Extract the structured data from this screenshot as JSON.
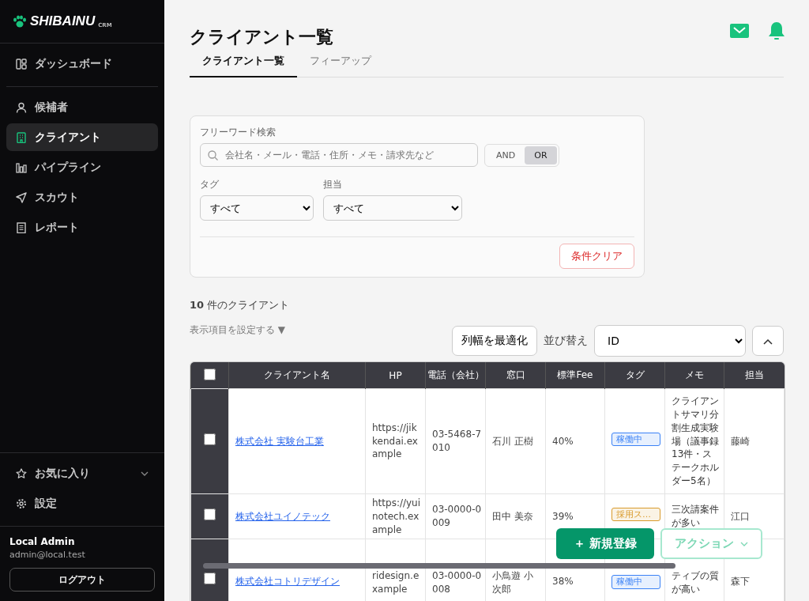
{
  "brand": {
    "name": "SHIBAINU",
    "sub": "CRM"
  },
  "nav_top": [
    {
      "label": "ダッシュボード",
      "selected": false
    }
  ],
  "nav": [
    {
      "label": "候補者",
      "selected": false
    },
    {
      "label": "クライアント",
      "selected": true
    },
    {
      "label": "パイプライン",
      "selected": false
    },
    {
      "label": "スカウト",
      "selected": false
    },
    {
      "label": "レポート",
      "selected": false
    }
  ],
  "nav_bottom": [
    {
      "label": "お気に入り",
      "expanded": false
    },
    {
      "label": "設定"
    }
  ],
  "user": {
    "name": "Local Admin",
    "email": "admin@local.test",
    "logout": "ログアウト"
  },
  "title": "クライアント一覧",
  "tabs": [
    {
      "label": "クライアント一覧",
      "selected": true
    },
    {
      "label": "フィーアップ",
      "selected": false
    }
  ],
  "filter": {
    "search_label": "フリーワード検索",
    "search_placeholder": "会社名・メール・電話・住所・メモ・請求先など",
    "modes": [
      {
        "label": "AND",
        "selected": false
      },
      {
        "label": "OR",
        "selected": true
      }
    ],
    "selects": [
      {
        "label": "タグ",
        "value": "すべて"
      },
      {
        "label": "担当",
        "value": "すべて"
      }
    ],
    "clear": "条件クリア"
  },
  "count": {
    "number": "10",
    "text": "件のクライアント"
  },
  "columns_toggle": "表示項目を設定する ▼",
  "fit_button": "列幅を最適化",
  "sort_label": "並び替え",
  "sort_value": "ID",
  "table": {
    "all_checked": false,
    "columns": [
      "クライアント名",
      "HP",
      "電話（会社）",
      "窓口",
      "標準Fee",
      "タグ",
      "メモ",
      "担当"
    ],
    "rows": [
      {
        "checked": false,
        "name": "株式会社 実験台工業",
        "hp": "https://jikkendai.example",
        "phone": "03-5468-7010",
        "contact": "石川 正樹",
        "fee": "40%",
        "tag": "稼働中",
        "color": "#3b82f6",
        "memo": "クライアントサマリ分割生成実験場（議事録13件・ステークホルダー5名）",
        "owner": "藤崎"
      },
      {
        "checked": false,
        "name": "株式会社ユイノテック",
        "hp": "https://yuinotech.example",
        "phone": "03-0000-0009",
        "contact": "田中 美奈",
        "fee": "39%",
        "tag": "採用ス…",
        "color": "#d99a2b",
        "memo": "三次請案件が多い",
        "owner": "江口"
      },
      {
        "checked": false,
        "name": "株式会社コトリデザイン",
        "hp": "ridesign.example",
        "phone": "03-0000-0008",
        "contact": "小鳥遊 小次郎",
        "fee": "38%",
        "tag": "稼働中",
        "color": "#3b82f6",
        "memo": "ティブの質が高い",
        "owner": "森下"
      }
    ]
  },
  "fab": {
    "primary": "＋ 新規登録",
    "secondary": "アクション"
  }
}
